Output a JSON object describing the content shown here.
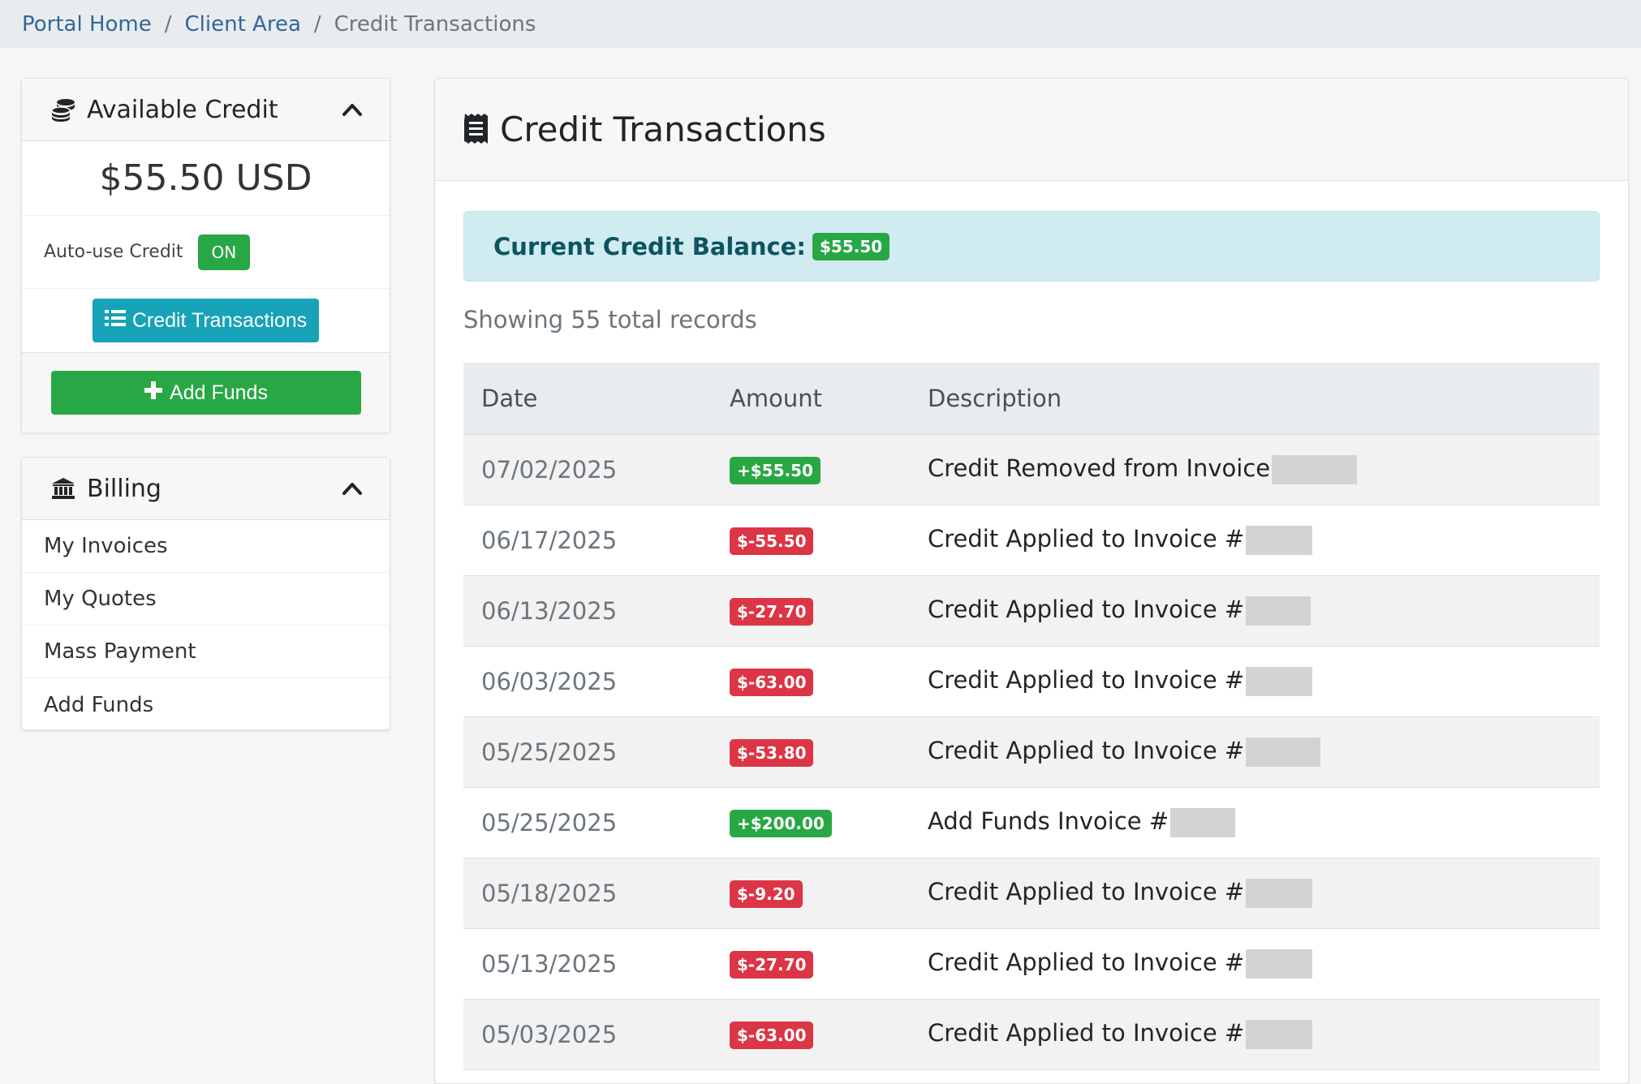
{
  "breadcrumb": {
    "items": [
      "Portal Home",
      "Client Area"
    ],
    "current": "Credit Transactions"
  },
  "sidebar": {
    "available_credit": {
      "title": "Available Credit",
      "amount": "$55.50 USD",
      "auto_use_label": "Auto-use Credit",
      "auto_use_status": "ON",
      "transactions_button": "Credit Transactions",
      "add_funds_button": "Add Funds"
    },
    "billing": {
      "title": "Billing",
      "items": [
        "My Invoices",
        "My Quotes",
        "Mass Payment",
        "Add Funds"
      ]
    }
  },
  "main": {
    "title": "Credit Transactions",
    "balance_label": "Current Credit Balance:",
    "balance_value": "$55.50",
    "showing": "Showing 55 total records",
    "columns": [
      "Date",
      "Amount",
      "Description"
    ],
    "rows": [
      {
        "date": "07/02/2025",
        "amount": "+$55.50",
        "type": "credit",
        "desc": "Credit Removed from Invoice"
      },
      {
        "date": "06/17/2025",
        "amount": "$-55.50",
        "type": "debit",
        "desc": "Credit Applied to Invoice #"
      },
      {
        "date": "06/13/2025",
        "amount": "$-27.70",
        "type": "debit",
        "desc": "Credit Applied to Invoice #"
      },
      {
        "date": "06/03/2025",
        "amount": "$-63.00",
        "type": "debit",
        "desc": "Credit Applied to Invoice #"
      },
      {
        "date": "05/25/2025",
        "amount": "$-53.80",
        "type": "debit",
        "desc": "Credit Applied to Invoice #"
      },
      {
        "date": "05/25/2025",
        "amount": "+$200.00",
        "type": "credit",
        "desc": "Add Funds Invoice #"
      },
      {
        "date": "05/18/2025",
        "amount": "$-9.20",
        "type": "debit",
        "desc": "Credit Applied to Invoice #"
      },
      {
        "date": "05/13/2025",
        "amount": "$-27.70",
        "type": "debit",
        "desc": "Credit Applied to Invoice #"
      },
      {
        "date": "05/03/2025",
        "amount": "$-63.00",
        "type": "debit",
        "desc": "Credit Applied to Invoice #"
      }
    ]
  },
  "colors": {
    "success": "#28a745",
    "danger": "#dc3545",
    "info": "#17a2b8",
    "alert_bg": "#d1ecf1",
    "link": "#336699"
  },
  "icons": {
    "available_credit": "coins-icon",
    "billing": "bank-icon",
    "main_title": "receipt-icon",
    "collapse": "chevron-up-icon",
    "transactions": "list-icon",
    "add_funds": "plus-icon"
  }
}
